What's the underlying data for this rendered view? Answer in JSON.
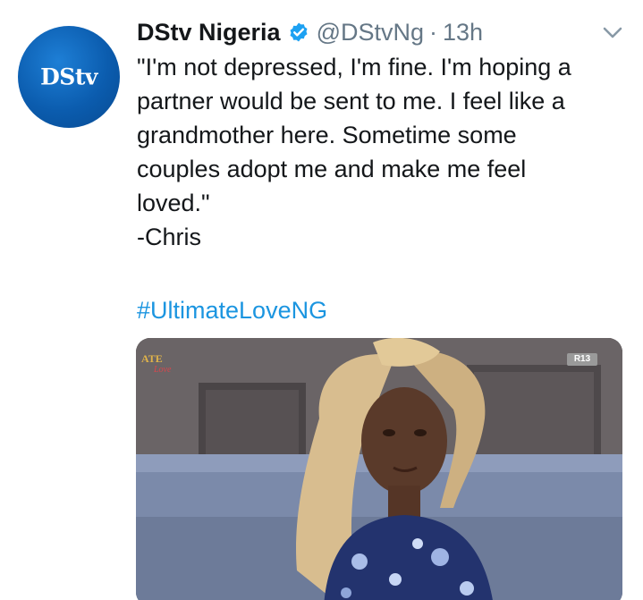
{
  "tweet": {
    "avatar": {
      "logo_text": "DStv",
      "brand_color": "#0b5cae"
    },
    "author_name": "DStv Nigeria",
    "verified_icon": "verified-badge-icon",
    "handle": "@DStvNg",
    "separator": "·",
    "timestamp": "13h",
    "menu_icon": "chevron-down-icon",
    "text_lines": [
      "\"I'm not depressed, I'm fine. I'm hoping a",
      "partner would be sent to me. I feel like a",
      "grandmother here. Sometime some",
      "couples adopt me and make me feel",
      "loved.\"",
      "-Chris"
    ],
    "hashtag": "#UltimateLoveNG",
    "link_color": "#1b95e0",
    "media": {
      "show_logo_text": "ATE",
      "show_logo_sub": "Love",
      "rating_badge": "R13"
    }
  }
}
